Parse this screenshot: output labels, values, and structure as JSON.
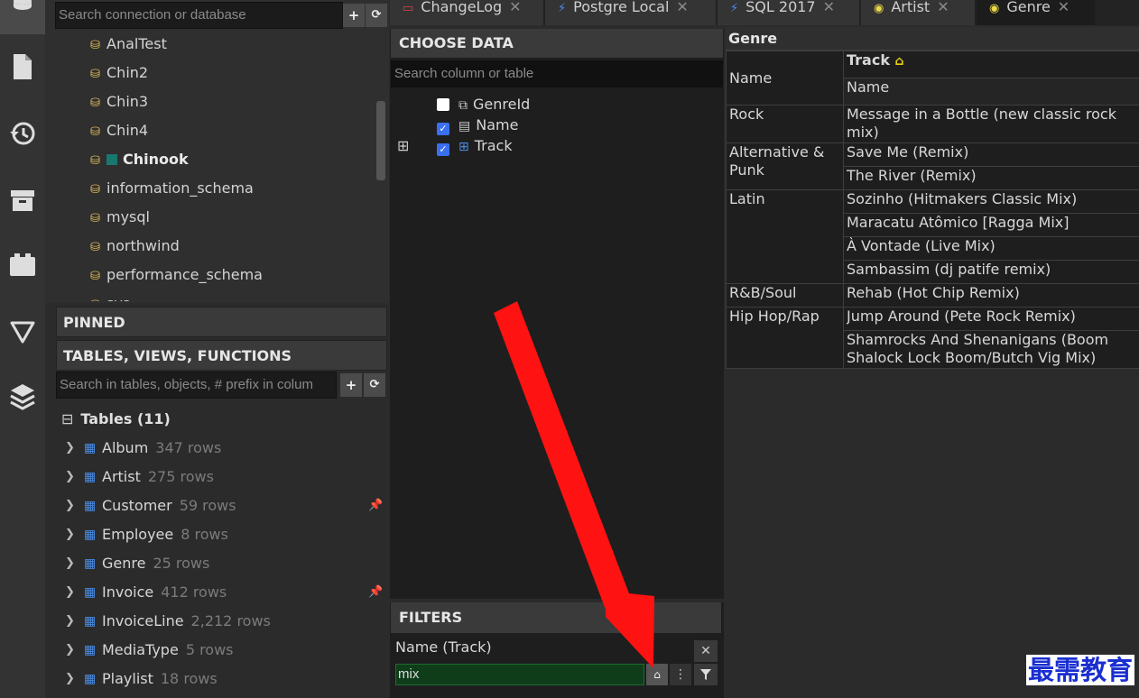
{
  "connections": {
    "search_placeholder": "Search connection or database",
    "add_label": "+",
    "refresh_label": "C",
    "databases": [
      {
        "name": "AnalTest"
      },
      {
        "name": "Chin2"
      },
      {
        "name": "Chin3"
      },
      {
        "name": "Chin4"
      },
      {
        "name": "Chinook",
        "active": true
      },
      {
        "name": "information_schema"
      },
      {
        "name": "mysql"
      },
      {
        "name": "northwind"
      },
      {
        "name": "performance_schema"
      },
      {
        "name": "sys"
      }
    ]
  },
  "pinned": {
    "title": "PINNED"
  },
  "objects": {
    "title": "TABLES, VIEWS, FUNCTIONS",
    "search_placeholder": "Search in tables, objects, # prefix in colum",
    "add_label": "+",
    "refresh_label": "C",
    "group_label": "Tables (11)",
    "tables": [
      {
        "name": "Album",
        "rows": "347 rows",
        "pinned": false
      },
      {
        "name": "Artist",
        "rows": "275 rows",
        "pinned": false
      },
      {
        "name": "Customer",
        "rows": "59 rows",
        "pinned": true
      },
      {
        "name": "Employee",
        "rows": "8 rows",
        "pinned": false
      },
      {
        "name": "Genre",
        "rows": "25 rows",
        "pinned": false
      },
      {
        "name": "Invoice",
        "rows": "412 rows",
        "pinned": true
      },
      {
        "name": "InvoiceLine",
        "rows": "2,212 rows",
        "pinned": false
      },
      {
        "name": "MediaType",
        "rows": "5 rows",
        "pinned": false
      },
      {
        "name": "Playlist",
        "rows": "18 rows",
        "pinned": false
      }
    ]
  },
  "tabs": [
    {
      "label": "ChangeLog",
      "icon": "changelog-icon",
      "icon_color": "#e0404a"
    },
    {
      "label": "Postgre Local",
      "icon": "plug-icon",
      "icon_color": "#4a8ef0"
    },
    {
      "label": "SQL 2017",
      "icon": "plug-icon",
      "icon_color": "#4a8ef0"
    },
    {
      "label": "Artist",
      "icon": "eye-icon",
      "icon_color": "#e8d84a"
    },
    {
      "label": "Genre",
      "icon": "eye-icon",
      "icon_color": "#e8d84a",
      "active": true
    }
  ],
  "choose_data": {
    "title": "CHOOSE DATA",
    "search_placeholder": "Search column or table",
    "columns": [
      {
        "label": "GenreId",
        "checked": false,
        "icon": "key-icon"
      },
      {
        "label": "Name",
        "checked": true,
        "icon": "column-icon"
      },
      {
        "label": "Track",
        "checked": true,
        "icon": "table-icon",
        "expand": "⊞"
      }
    ]
  },
  "filters": {
    "title": "FILTERS",
    "field_label": "Name (Track)",
    "value": "mix",
    "close_label": "✕"
  },
  "results": {
    "table_title": "Genre",
    "col_name": "Name",
    "nested_title": "Track",
    "nested_col": "Name",
    "groups": [
      {
        "genre": "Rock",
        "tracks": [
          "Message in a Bottle (new classic rock mix)"
        ]
      },
      {
        "genre": "Alternative & Punk",
        "tracks": [
          "Save Me (Remix)",
          "The River (Remix)"
        ]
      },
      {
        "genre": "Latin",
        "tracks": [
          "Sozinho (Hitmakers Classic Mix)",
          "Maracatu Atômico [Ragga Mix]",
          "À Vontade (Live Mix)",
          "Sambassim (dj patife remix)"
        ]
      },
      {
        "genre": "R&B/Soul",
        "tracks": [
          "Rehab (Hot Chip Remix)"
        ]
      },
      {
        "genre": "Hip Hop/Rap",
        "tracks": [
          "Jump Around (Pete Rock Remix)",
          "Shamrocks And Shenanigans (Boom Shalock Lock Boom/Butch Vig Mix)"
        ]
      }
    ]
  },
  "watermark": "最需教育",
  "colors": {
    "accent": "#3a6ff0",
    "arrow": "#ff1a1a",
    "filter_green": "#0f3d1a"
  }
}
